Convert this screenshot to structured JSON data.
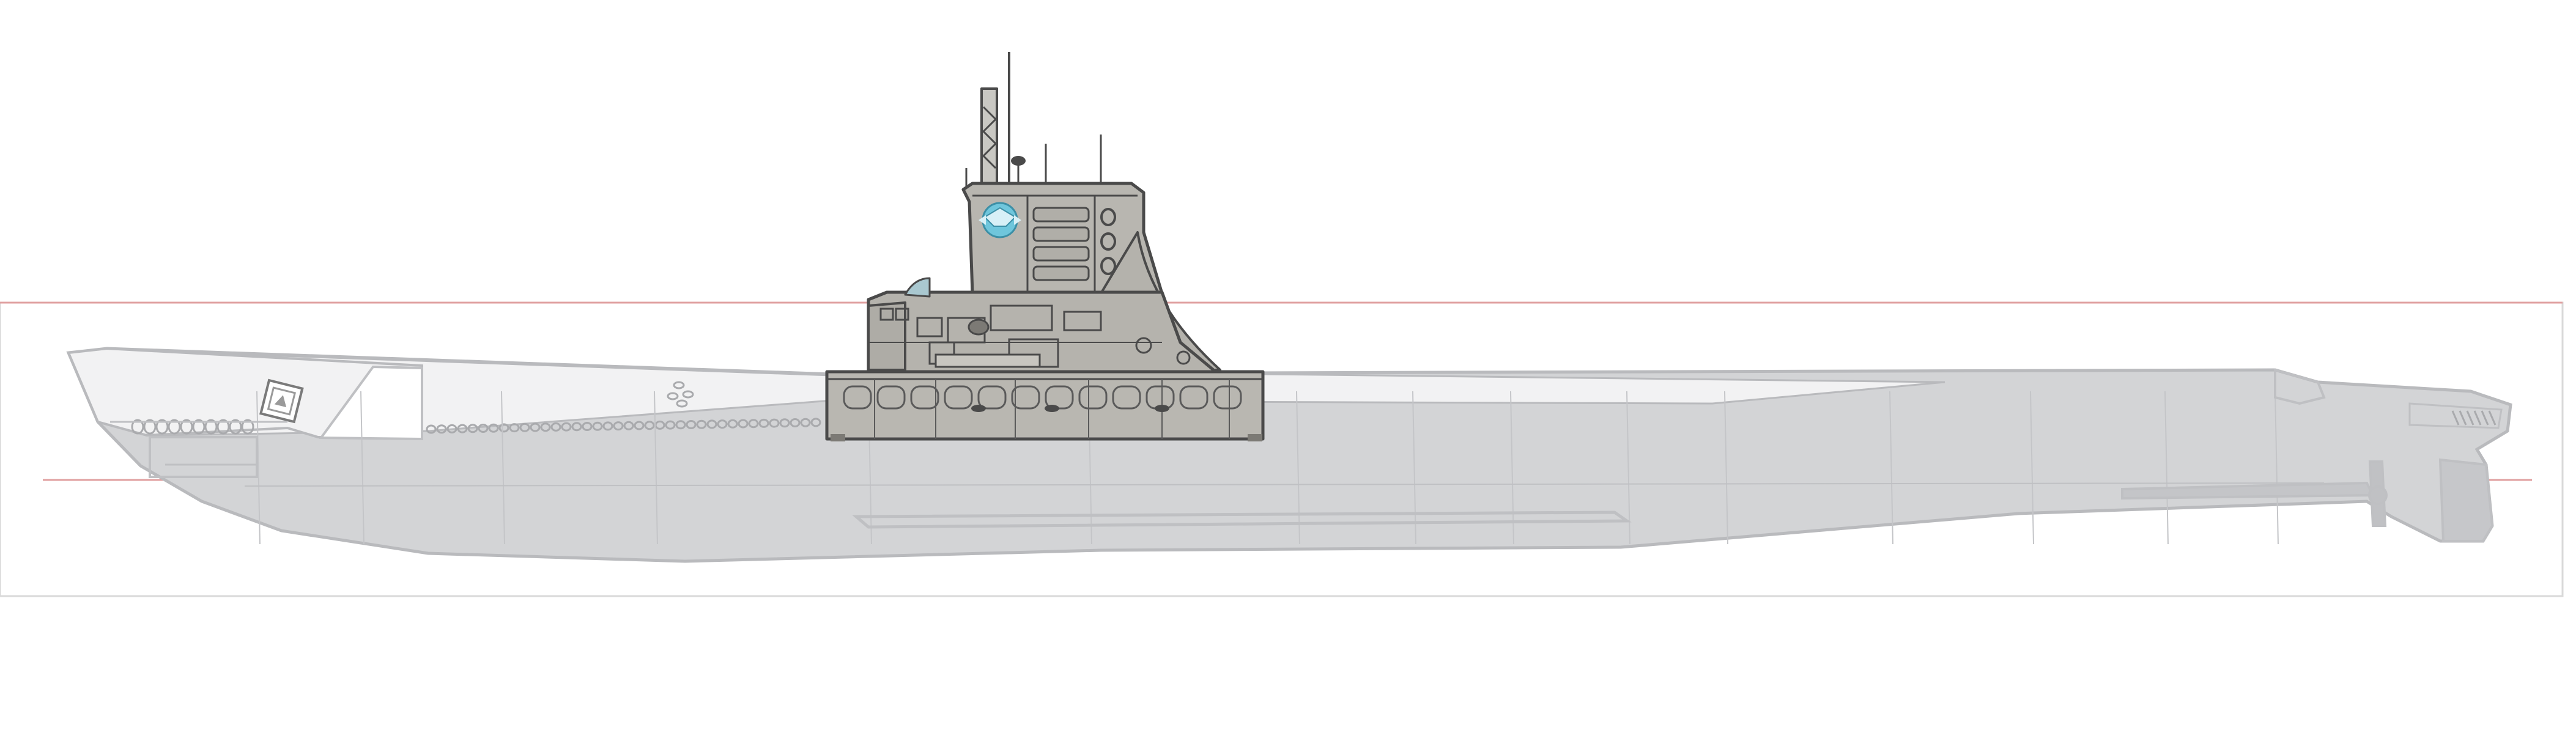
{
  "drawing": {
    "subject": "submarine-side-profile",
    "emblem_icon": "winged-emblem-icon",
    "bow_emblem_icon": "square-emblem-icon"
  },
  "colors": {
    "background": "#ffffff",
    "hull_fill": "#d3d4d6",
    "hull_stroke": "#b9babd",
    "hull_line": "#bfc0c3",
    "deck_light": "#f2f2f3",
    "tower_fill": "#b8b6b0",
    "tower_stroke": "#4a4a4a",
    "tower_dark": "#7c7a75",
    "emblem": "#6fc6dc",
    "guide_line": "#e0a0a0",
    "frame_line": "#d9d9d9"
  }
}
